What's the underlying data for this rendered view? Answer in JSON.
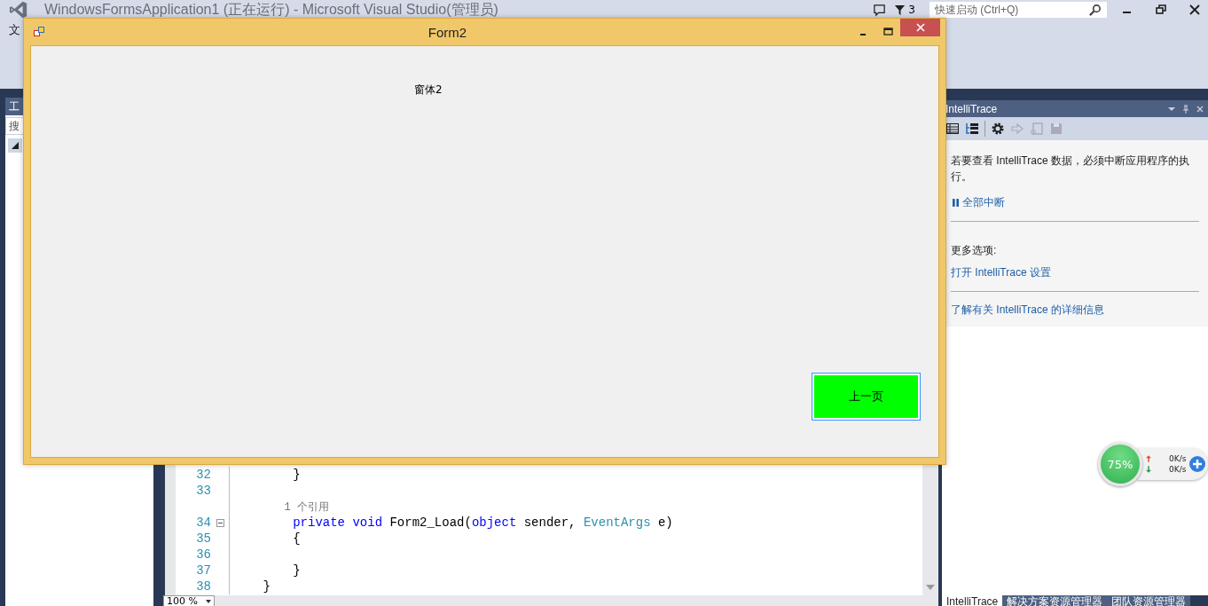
{
  "vs_window": {
    "title": "WindowsFormsApplication1 (正在运行) - Microsoft Visual Studio(管理员)",
    "notification_count": "3",
    "quick_launch": {
      "placeholder": "快速启动 (Ctrl+Q)"
    }
  },
  "menu": [
    "文"
  ],
  "toolbox": {
    "title": "工",
    "search": {
      "placeholder": "搜"
    }
  },
  "editor": {
    "lines": [
      {
        "kind": "code",
        "number": "32",
        "tokens": [
          {
            "kind": "plain",
            "text": "        }"
          }
        ]
      },
      {
        "kind": "code",
        "number": "33"
      },
      {
        "kind": "codelens",
        "tokens": [
          {
            "kind": "plain",
            "text": "        1 个引用"
          }
        ]
      },
      {
        "kind": "code",
        "number": "34",
        "collapsible": true,
        "tokens": [
          {
            "kind": "keyword",
            "text": "        private"
          },
          {
            "kind": "keyword",
            "text": " void"
          },
          {
            "kind": "plain",
            "text": " Form2_Load("
          },
          {
            "kind": "keyword",
            "text": "object"
          },
          {
            "kind": "plain",
            "text": " sender, "
          },
          {
            "kind": "type",
            "text": "EventArgs"
          },
          {
            "kind": "plain",
            "text": " e)"
          }
        ]
      },
      {
        "kind": "code",
        "number": "35",
        "tokens": [
          {
            "kind": "plain",
            "text": "        {"
          }
        ]
      },
      {
        "kind": "code",
        "number": "36"
      },
      {
        "kind": "code",
        "number": "37",
        "tokens": [
          {
            "kind": "plain",
            "text": "        }"
          }
        ]
      },
      {
        "kind": "code",
        "number": "38",
        "tokens": [
          {
            "kind": "plain",
            "text": "    }"
          }
        ]
      }
    ],
    "zoom": "100 %"
  },
  "intellitrace": {
    "title": "IntelliTrace",
    "message": "若要查看 IntelliTrace 数据，必须中断应用程序的执行。",
    "break_all": "全部中断",
    "more_options": "更多选项:",
    "open_settings": "打开 IntelliTrace 设置",
    "learn_more": "了解有关 IntelliTrace 的详细信息"
  },
  "bottom_tabs": [
    {
      "label": "IntelliTrace",
      "selected": true
    },
    {
      "label": "解决方案资源管理器",
      "selected": false
    },
    {
      "label": "团队资源管理器",
      "selected": false
    }
  ],
  "form2": {
    "title": "Form2",
    "label": "窗体2",
    "button": "上一页"
  },
  "speed_widget": {
    "percent": "75%",
    "upload": "0K/s",
    "download": "0K/s"
  }
}
